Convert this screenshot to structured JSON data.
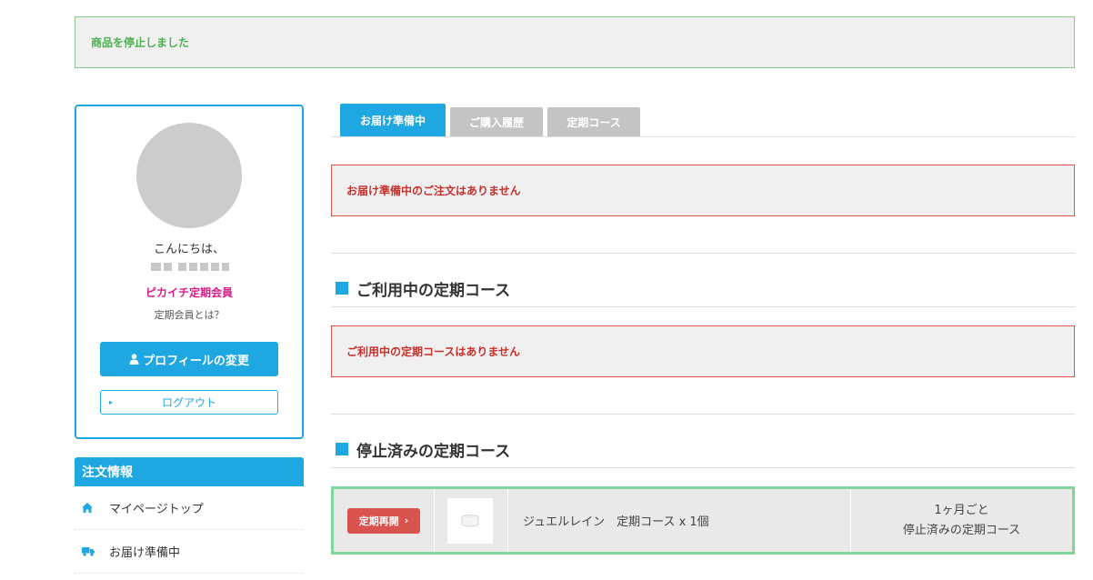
{
  "notice": {
    "text": "商品を停止しました"
  },
  "profile": {
    "greeting": "こんにちは、",
    "member_type": "ピカイチ定期会員",
    "member_link": "定期会員とは？",
    "profile_button": "プロフィールの変更",
    "logout_button": "ログアウト"
  },
  "sidebar": {
    "heading": "注文情報",
    "items": [
      {
        "label": "マイページトップ",
        "icon": "home-icon"
      },
      {
        "label": "お届け準備中",
        "icon": "truck-icon"
      }
    ]
  },
  "tabs": [
    {
      "label": "お届け準備中",
      "active": true
    },
    {
      "label": "ご購入履歴",
      "active": false
    },
    {
      "label": "定期コース",
      "active": false
    }
  ],
  "messages": {
    "no_pending_orders": "お届け準備中のご注文はありません",
    "no_active_courses": "ご利用中の定期コースはありません"
  },
  "sections": {
    "active_courses_title": "ご利用中の定期コース",
    "stopped_courses_title": "停止済みの定期コース"
  },
  "stopped_courses": [
    {
      "resume_button": "定期再開",
      "product": "ジュエルレイン　定期コース x 1個",
      "frequency": "1ヶ月ごと",
      "status": "停止済みの定期コース"
    }
  ],
  "colors": {
    "accent": "#1ea7e1",
    "notice_text": "#4caf50",
    "error_text": "#c9302c",
    "member_pink": "#d81b8a",
    "resume_red": "#d9534f",
    "highlight_green": "#7fd89a"
  }
}
